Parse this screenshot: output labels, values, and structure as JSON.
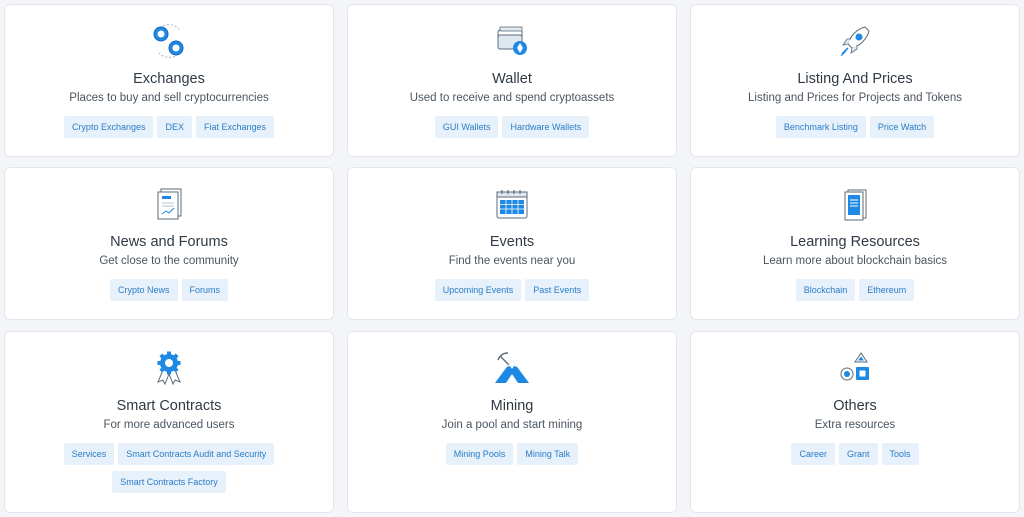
{
  "colors": {
    "accent": "#2b7dc6",
    "tag_bg": "#e7f1fb",
    "icon_blue": "#1e88e5"
  },
  "cards": [
    {
      "title": "Exchanges",
      "subtitle": "Places to buy and sell cryptocurrencies",
      "icon": "coin-exchange-icon",
      "tags": [
        "Crypto Exchanges",
        "DEX",
        "Fiat Exchanges"
      ]
    },
    {
      "title": "Wallet",
      "subtitle": "Used to receive and spend cryptoassets",
      "icon": "wallet-icon",
      "tags": [
        "GUI Wallets",
        "Hardware Wallets"
      ]
    },
    {
      "title": "Listing And Prices",
      "subtitle": "Listing and Prices for Projects and Tokens",
      "icon": "rocket-icon",
      "tags": [
        "Benchmark Listing",
        "Price Watch"
      ]
    },
    {
      "title": "News and Forums",
      "subtitle": "Get close to the community",
      "icon": "newspaper-icon",
      "tags": [
        "Crypto News",
        "Forums"
      ]
    },
    {
      "title": "Events",
      "subtitle": "Find the events near you",
      "icon": "calendar-icon",
      "tags": [
        "Upcoming Events",
        "Past Events"
      ]
    },
    {
      "title": "Learning Resources",
      "subtitle": "Learn more about blockchain basics",
      "icon": "book-icon",
      "tags": [
        "Blockchain",
        "Ethereum"
      ]
    },
    {
      "title": "Smart Contracts",
      "subtitle": "For more advanced users",
      "icon": "gear-ribbon-icon",
      "tags": [
        "Services",
        "Smart Contracts Audit and Security",
        "Smart Contracts Factory"
      ]
    },
    {
      "title": "Mining",
      "subtitle": "Join a pool and start mining",
      "icon": "mountain-pickaxe-icon",
      "tags": [
        "Mining Pools",
        "Mining Talk"
      ]
    },
    {
      "title": "Others",
      "subtitle": "Extra resources",
      "icon": "shapes-icon",
      "tags": [
        "Career",
        "Grant",
        "Tools"
      ]
    }
  ]
}
